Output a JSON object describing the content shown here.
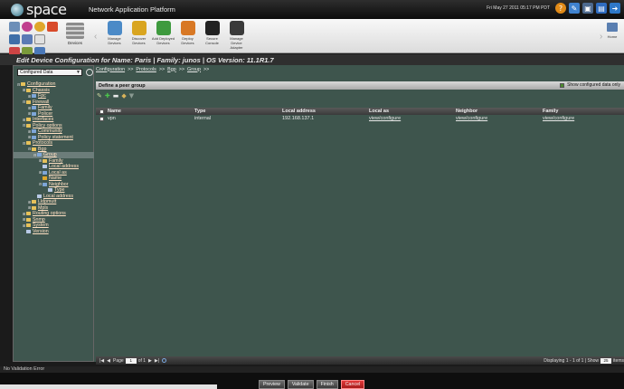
{
  "app": {
    "logo": "space",
    "title": "Network Application Platform",
    "datetime": "Fri May 27 2011 05:17 PM PDT"
  },
  "ribbon": {
    "devices_label": "Devices",
    "home_label": "Home",
    "actions": [
      {
        "label": "Manage Devices",
        "icon": "manage-devices-icon",
        "color": "#4b8ac7"
      },
      {
        "label": "Discover Devices",
        "icon": "discover-devices-icon",
        "color": "#d9a520"
      },
      {
        "label": "Add Deployed Devices",
        "icon": "add-deployed-icon",
        "color": "#3e9a3e"
      },
      {
        "label": "Deploy Devices",
        "icon": "deploy-devices-icon",
        "color": "#d87824"
      },
      {
        "label": "Secure Console",
        "icon": "secure-console-icon",
        "color": "#222222"
      },
      {
        "label": "Manage Device Adapter",
        "icon": "device-adapter-icon",
        "color": "#3a3a3a"
      }
    ]
  },
  "edit_title": "Edit Device Configuration for Name: Paris | Family: junos | OS Version: 11.1R1.7",
  "filter": {
    "value": "Configured Data"
  },
  "tree": [
    {
      "label": "Configuration",
      "indent": 0,
      "toggle": "⊟",
      "icon": "folder-icon"
    },
    {
      "label": "Chassis",
      "indent": 1,
      "toggle": "⊞",
      "icon": "folder-icon"
    },
    {
      "label": "Fpc",
      "indent": 2,
      "toggle": "⊞",
      "icon": "node-icon"
    },
    {
      "label": "Firewall",
      "indent": 1,
      "toggle": "⊟",
      "icon": "folder-icon"
    },
    {
      "label": "Family",
      "indent": 2,
      "toggle": "⊞",
      "icon": "node-icon"
    },
    {
      "label": "Policer",
      "indent": 2,
      "toggle": "⊞",
      "icon": "node-icon"
    },
    {
      "label": "Interfaces",
      "indent": 1,
      "toggle": "⊞",
      "icon": "folder-icon"
    },
    {
      "label": "Policy options",
      "indent": 1,
      "toggle": "⊟",
      "icon": "folder-icon"
    },
    {
      "label": "Community",
      "indent": 2,
      "toggle": "⊞",
      "icon": "node-icon"
    },
    {
      "label": "Policy statement",
      "indent": 2,
      "toggle": "⊞",
      "icon": "node-icon"
    },
    {
      "label": "Protocols",
      "indent": 1,
      "toggle": "⊟",
      "icon": "folder-icon"
    },
    {
      "label": "Bgp",
      "indent": 2,
      "toggle": "⊟",
      "icon": "folder-icon"
    },
    {
      "label": "Group",
      "indent": 3,
      "toggle": "⊟",
      "icon": "node-icon",
      "selected": true
    },
    {
      "label": "Family",
      "indent": 4,
      "toggle": "⊞",
      "icon": "folder-icon"
    },
    {
      "label": "Local address",
      "indent": 4,
      "toggle": "",
      "icon": "leaf-icon"
    },
    {
      "label": "Local as",
      "indent": 4,
      "toggle": "⊞",
      "icon": "node-icon"
    },
    {
      "label": "Name",
      "indent": 4,
      "toggle": "",
      "icon": "key-icon"
    },
    {
      "label": "Neighbor",
      "indent": 4,
      "toggle": "⊟",
      "icon": "node-icon"
    },
    {
      "label": "Type",
      "indent": 5,
      "toggle": "",
      "icon": "leaf-icon"
    },
    {
      "label": "Local address",
      "indent": 3,
      "toggle": "",
      "icon": "leaf-icon"
    },
    {
      "label": "Lldpmutt",
      "indent": 2,
      "toggle": "⊞",
      "icon": "folder-icon"
    },
    {
      "label": "Mpls",
      "indent": 2,
      "toggle": "⊞",
      "icon": "folder-icon"
    },
    {
      "label": "Routing options",
      "indent": 1,
      "toggle": "⊞",
      "icon": "folder-icon"
    },
    {
      "label": "Snmp",
      "indent": 1,
      "toggle": "⊞",
      "icon": "folder-icon"
    },
    {
      "label": "System",
      "indent": 1,
      "toggle": "⊞",
      "icon": "folder-icon"
    },
    {
      "label": "Version",
      "indent": 1,
      "toggle": "",
      "icon": "leaf-icon"
    }
  ],
  "breadcrumb": [
    "Configuration",
    "Protocols",
    "Bgp",
    "Group"
  ],
  "breadcrumb_sep": ">>",
  "section": {
    "title": "Define a peer group",
    "show_configured_label": "Show configured data only"
  },
  "grid": {
    "columns": [
      "Name",
      "Type",
      "Local address",
      "Local as",
      "Neighbor",
      "Family"
    ],
    "rows": [
      [
        "vpn",
        "internal",
        "192.168.137.1",
        "view/configure",
        "view/configure",
        "view/configure"
      ]
    ]
  },
  "pager": {
    "page_label": "Page",
    "page_value": "1",
    "of_label": "of 1",
    "display_text": "Displaying 1 - 1 of 1 | Show",
    "page_size": "25",
    "items_label": "items"
  },
  "status": "No Validation Error",
  "buttons": {
    "preview": "Preview",
    "validate": "Validate",
    "finish": "Finish",
    "cancel": "Cancel"
  },
  "colors": {
    "tree_bg": "#3f564f",
    "link": "#ffe0c2",
    "cancel": "#d02c2c"
  }
}
